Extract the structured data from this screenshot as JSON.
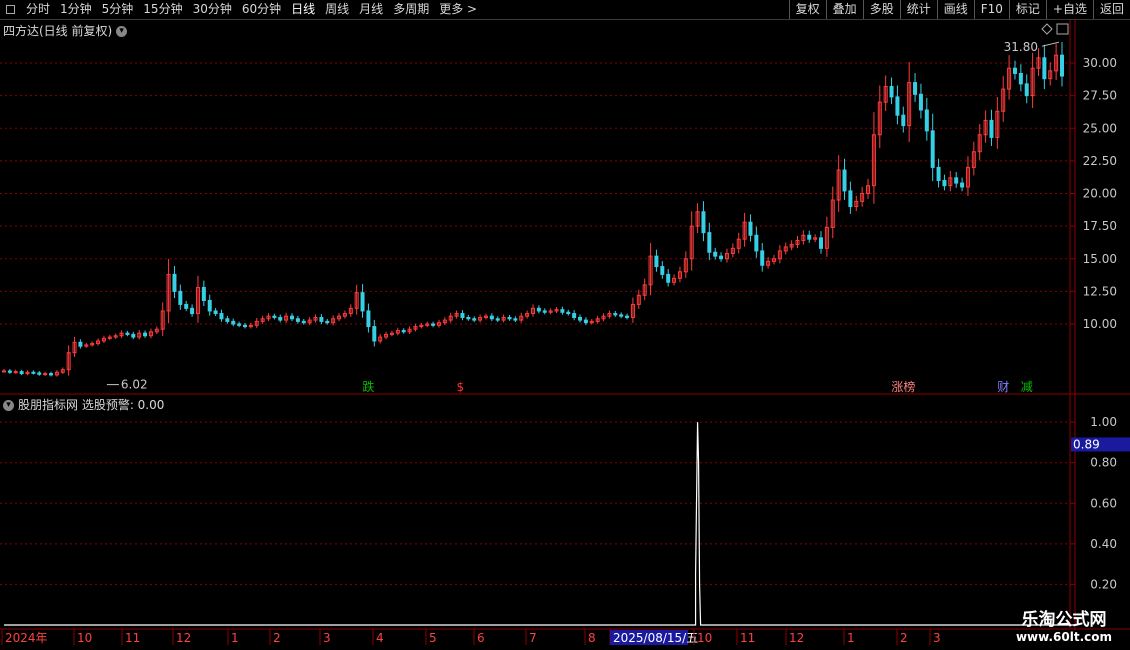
{
  "toolbar": {
    "periods": [
      "分时",
      "1分钟",
      "5分钟",
      "15分钟",
      "30分钟",
      "60分钟",
      "日线",
      "周线",
      "月线",
      "多周期",
      "更多 >"
    ],
    "active_period": "日线",
    "actions": [
      "复权",
      "叠加",
      "多股",
      "统计",
      "画线",
      "F10",
      "标记",
      "+自选",
      "返回"
    ]
  },
  "main_panel": {
    "title": "四方达(日线 前复权)",
    "high_label": "31.80",
    "low_label": "6.02",
    "markers": [
      {
        "text": "跌",
        "color": "#00c000",
        "idx": 62
      },
      {
        "text": "$",
        "color": "#ff3030",
        "idx": 78
      },
      {
        "text": "涨榜",
        "color": "#ff8080",
        "idx": 152
      },
      {
        "text": "财",
        "color": "#8080ff",
        "idx": 170
      },
      {
        "text": "减",
        "color": "#00c000",
        "idx": 174
      }
    ]
  },
  "sub_panel": {
    "title": "股朋指标网 选股预警: 0.00",
    "current_value_label": "0.89"
  },
  "time_axis": {
    "labels": [
      "2024年",
      "10",
      "11",
      "12",
      "1",
      "2",
      "3",
      "4",
      "5",
      "6",
      "7",
      "8",
      "2025/08/15/五",
      "10",
      "11",
      "12",
      "1",
      "2",
      "3"
    ],
    "highlight": "2025/08/15/五"
  },
  "colors": {
    "up": "#ff3c3c",
    "down": "#36d0e6",
    "grid": "#8b0000",
    "axis": "#8b0000",
    "text": "#c8c8c8",
    "signal": "#ffffff"
  },
  "watermark": {
    "line1": "乐淘公式网",
    "line2": "www.60lt.com"
  },
  "chart_data": [
    {
      "type": "candlestick",
      "title": "四方达(日线 前复权)",
      "ylim": [
        5,
        32.5
      ],
      "y_ticks": [
        10.0,
        12.5,
        15.0,
        17.5,
        20.0,
        22.5,
        25.0,
        27.5,
        30.0
      ],
      "x_tick_labels": [
        "2024年",
        "10",
        "11",
        "12",
        "1",
        "2",
        "3",
        "4",
        "5",
        "6",
        "7",
        "8",
        "2025/08/15/五",
        "10",
        "11",
        "12",
        "1",
        "2",
        "3"
      ],
      "close_series": [
        6.4,
        6.3,
        6.35,
        6.2,
        6.3,
        6.25,
        6.15,
        6.2,
        6.1,
        6.3,
        6.5,
        7.8,
        8.6,
        8.3,
        8.4,
        8.5,
        8.7,
        8.9,
        9.0,
        9.1,
        9.3,
        9.2,
        9.0,
        9.3,
        9.1,
        9.4,
        9.6,
        11.0,
        13.8,
        12.5,
        11.5,
        11.2,
        10.8,
        12.8,
        11.8,
        11.0,
        10.8,
        10.4,
        10.2,
        10.0,
        9.9,
        9.8,
        9.9,
        10.2,
        10.4,
        10.6,
        10.5,
        10.3,
        10.6,
        10.4,
        10.2,
        10.1,
        10.3,
        10.5,
        10.2,
        10.1,
        10.4,
        10.6,
        10.8,
        11.2,
        12.4,
        11.0,
        9.8,
        8.7,
        9.0,
        9.2,
        9.3,
        9.5,
        9.4,
        9.6,
        9.8,
        9.9,
        10.0,
        9.9,
        10.1,
        10.3,
        10.6,
        10.8,
        10.5,
        10.4,
        10.3,
        10.5,
        10.6,
        10.4,
        10.3,
        10.5,
        10.4,
        10.3,
        10.6,
        10.8,
        11.2,
        11.0,
        10.9,
        11.0,
        11.1,
        10.9,
        10.8,
        10.5,
        10.3,
        10.1,
        10.2,
        10.4,
        10.6,
        10.8,
        10.7,
        10.6,
        10.5,
        11.5,
        12.2,
        13.0,
        15.2,
        14.4,
        13.8,
        13.2,
        13.5,
        14.0,
        15.0,
        17.5,
        18.6,
        17.0,
        15.5,
        15.2,
        15.0,
        15.4,
        15.8,
        16.5,
        17.8,
        16.8,
        15.6,
        14.5,
        14.8,
        15.0,
        15.6,
        15.9,
        16.1,
        16.4,
        16.8,
        16.5,
        16.6,
        15.8,
        17.4,
        19.5,
        21.8,
        20.2,
        19.0,
        19.4,
        20.0,
        20.6,
        24.5,
        27.0,
        28.2,
        27.4,
        26.0,
        25.2,
        28.5,
        27.6,
        26.4,
        24.8,
        22.0,
        21.0,
        20.6,
        21.2,
        20.8,
        20.5,
        22.0,
        23.2,
        24.5,
        25.6,
        24.3,
        26.3,
        28.0,
        29.6,
        29.2,
        28.4,
        27.5,
        29.6,
        30.4,
        28.8,
        29.4,
        30.6,
        29.0
      ],
      "annotations": [
        "31.80",
        "6.02"
      ]
    },
    {
      "type": "line",
      "title": "股朋指标网 选股预警: 0.00",
      "ylim": [
        0,
        1.05
      ],
      "y_ticks": [
        0.2,
        0.4,
        0.6,
        0.8,
        1.0
      ],
      "current_value": 0.89,
      "series": [
        {
          "name": "选股预警",
          "spike_index": 118,
          "spike_values": [
            0.25,
            1.0,
            0.8,
            0.2
          ],
          "base": 0.0
        }
      ]
    }
  ]
}
